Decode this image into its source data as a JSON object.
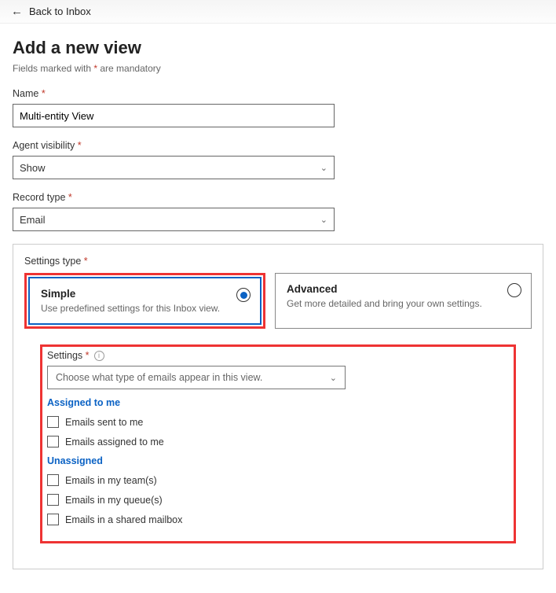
{
  "topbar": {
    "back_label": "Back to Inbox"
  },
  "header": {
    "title": "Add a new view",
    "mandatory_note_pre": "Fields marked with ",
    "mandatory_note_post": " are mandatory",
    "star": "*"
  },
  "fields": {
    "name": {
      "label": "Name",
      "value": "Multi-entity View"
    },
    "agent_vis": {
      "label": "Agent visibility",
      "value": "Show"
    },
    "record_type": {
      "label": "Record type",
      "value": "Email"
    }
  },
  "settings_type": {
    "label": "Settings type",
    "simple": {
      "title": "Simple",
      "desc": "Use predefined settings for this Inbox view."
    },
    "advanced": {
      "title": "Advanced",
      "desc": "Get more detailed and bring your own settings."
    }
  },
  "settings_dd": {
    "label": "Settings",
    "placeholder": "Choose what type of emails appear in this view.",
    "groups": [
      {
        "name": "Assigned to me",
        "items": [
          "Emails sent to me",
          "Emails assigned to me"
        ]
      },
      {
        "name": "Unassigned",
        "items": [
          "Emails in my team(s)",
          "Emails in my queue(s)",
          "Emails in a shared mailbox"
        ]
      }
    ]
  }
}
